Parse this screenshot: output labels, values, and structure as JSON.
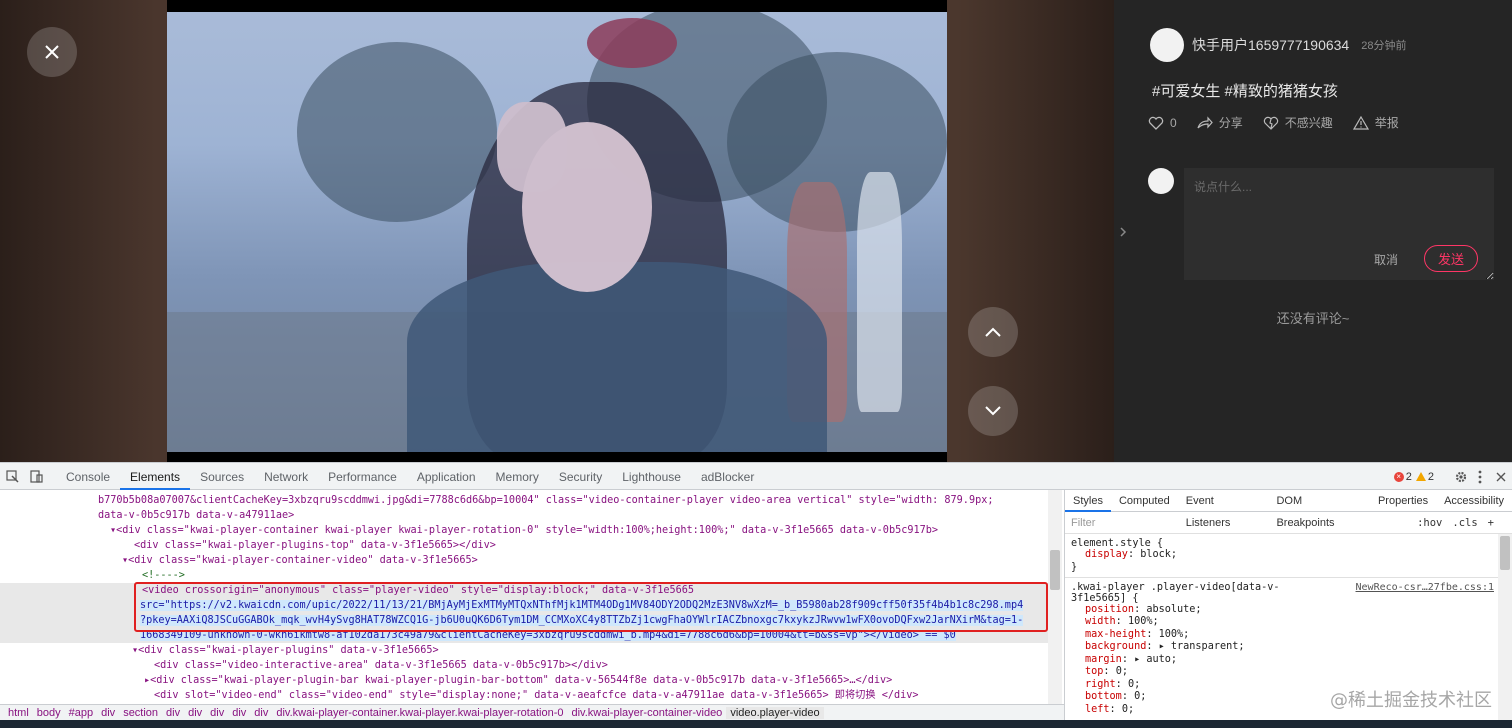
{
  "viewer": {
    "author_name": "快手用户1659777190634",
    "author_time": "28分钟前",
    "caption": "#可爱女生  #精致的猪猪女孩",
    "like_count": "0",
    "share_label": "分享",
    "dislike_label": "不感兴趣",
    "report_label": "举报",
    "comment_placeholder": "说点什么...",
    "cancel_label": "取消",
    "send_label": "发送",
    "no_comment_text": "还没有评论~"
  },
  "devtools": {
    "tabs": [
      "Console",
      "Elements",
      "Sources",
      "Network",
      "Performance",
      "Application",
      "Memory",
      "Security",
      "Lighthouse",
      "adBlocker"
    ],
    "active_tab": "Elements",
    "error_count": "2",
    "warning_count": "2",
    "elements_lines": [
      {
        "text": "b770b5b08a07007&clientCacheKey=3xbzqru9scddmwi.jpg&di=7788c6d6&bp=10004\" class=\"video-container-player video-area vertical\" style=\"width: 879.9px;",
        "indent": 98
      },
      {
        "text": "data-v-0b5c917b data-v-a47911ae>",
        "indent": 98
      },
      {
        "text": "▾<div class=\"kwai-player-container kwai-player kwai-player-rotation-0\" style=\"width:100%;height:100%;\" data-v-3f1e5665 data-v-0b5c917b>",
        "indent": 110
      },
      {
        "text": "<div class=\"kwai-player-plugins-top\" data-v-3f1e5665></div>",
        "indent": 134
      },
      {
        "text": "▾<div class=\"kwai-player-container-video\" data-v-3f1e5665>",
        "indent": 122
      },
      {
        "text": "<!---->",
        "indent": 142
      },
      {
        "text": "<video crossorigin=\"anonymous\" class=\"player-video\" style=\"display:block;\" data-v-3f1e5665",
        "indent": 142
      },
      {
        "text": "src=\"https://v2.kwaicdn.com/upic/2022/11/13/21/BMjAyMjExMTMyMTQxNThfMjk1MTM4ODg1MV84ODY2ODQ2MzE3NV8wXzM=_b_B5980ab28f909cff50f35f4b4b1c8c298.mp4",
        "indent": 140
      },
      {
        "text": "?pkey=AAXiQ8JSCuGGABOk_mqk_wvH4ySvg8HAT78WZCQ1G-jb6U0uQK6D6Tym1DM_CCMXoXC4y8TTZbZj1cwgFhaOYWlrIACZbnoxgc7kxykzJRwvw1wFX0ovoDQFxw2JarNXirM&tag=1-",
        "indent": 140
      },
      {
        "text": "1668349109-unknown-0-wkh6ikmtw8-af102da173c49a79&clientCacheKey=3xbzqru9scddmwi_b.mp4&di=7788c6d6&bp=10004&tt=b&ss=vp\"></video> == $0",
        "indent": 140
      },
      {
        "text": "▾<div class=\"kwai-player-plugins\" data-v-3f1e5665>",
        "indent": 132
      },
      {
        "text": "<div class=\"video-interactive-area\" data-v-3f1e5665 data-v-0b5c917b></div>",
        "indent": 154
      },
      {
        "text": "▸<div class=\"kwai-player-plugin-bar kwai-player-plugin-bar-bottom\" data-v-56544f8e data-v-0b5c917b data-v-3f1e5665>…</div>",
        "indent": 144
      },
      {
        "text": "<div slot=\"video-end\" class=\"video-end\" style=\"display:none;\" data-v-aeafcfce data-v-a47911ae data-v-3f1e5665> 即将切换 </div>",
        "indent": 154
      },
      {
        "text": "▸<div class=\"player-error\" style=\"display:none;\" data-v-96033432 data-v-0b5c917b data-v-3f1e5665>…</div>",
        "indent": 144
      }
    ],
    "breadcrumb": [
      "html",
      "body",
      "#app",
      "div",
      "section",
      "div",
      "div",
      "div",
      "div",
      "div",
      "div.kwai-player-container.kwai-player.kwai-player-rotation-0",
      "div.kwai-player-container-video",
      "video.player-video"
    ],
    "styles_tabs": [
      "Styles",
      "Computed",
      "Event Listeners",
      "DOM Breakpoints",
      "Properties",
      "Accessibility"
    ],
    "filter_placeholder": "Filter",
    "hov_label": ":hov",
    "cls_label": ".cls",
    "plus_label": "+",
    "element_style": {
      "selector": "element.style {",
      "props": [
        {
          "name": "display",
          "value": "block;"
        }
      ],
      "close": "}"
    },
    "rule": {
      "selector": ".kwai-player .player-video[data-v-",
      "selector2": "3f1e5665] {",
      "source": "NewReco-csr…27fbe.css:1",
      "props": [
        {
          "name": "position",
          "value": "absolute;"
        },
        {
          "name": "width",
          "value": "100%;"
        },
        {
          "name": "max-height",
          "value": "100%;"
        },
        {
          "name": "background",
          "value": "▸ transparent;"
        },
        {
          "name": "margin",
          "value": "▸ auto;"
        },
        {
          "name": "top",
          "value": "0;"
        },
        {
          "name": "right",
          "value": "0;"
        },
        {
          "name": "bottom",
          "value": "0;"
        },
        {
          "name": "left",
          "value": "0;"
        }
      ]
    }
  },
  "watermark": "@稀土掘金技术社区"
}
